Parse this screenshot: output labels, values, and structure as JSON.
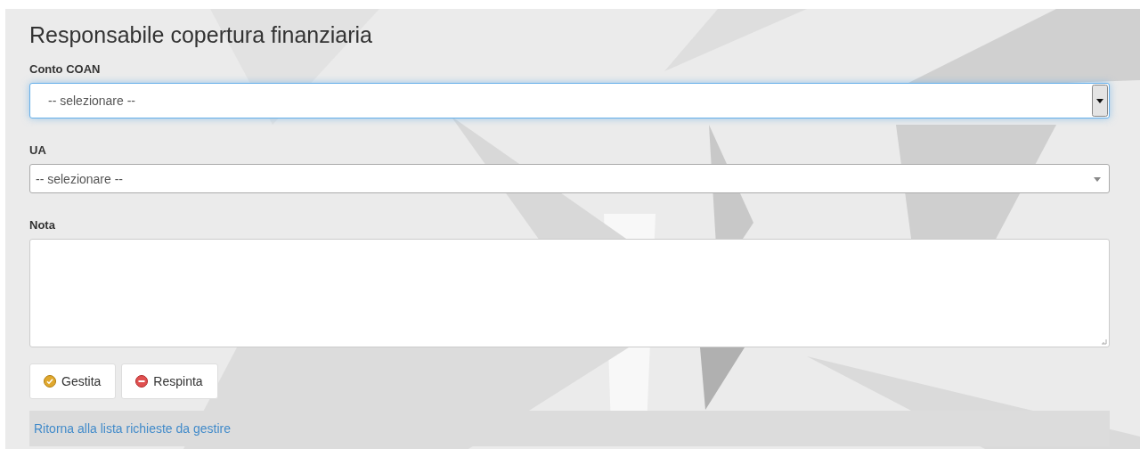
{
  "title": "Responsabile copertura finanziaria",
  "fields": [
    {
      "kind": "select",
      "label": "Conto COAN",
      "value": "-- selezionare --",
      "focused": true
    },
    {
      "kind": "select",
      "label": "UA",
      "value": "-- selezionare --",
      "focused": false
    },
    {
      "kind": "textarea",
      "label": "Nota"
    }
  ],
  "buttons": [
    {
      "label": "Gestita",
      "kind": "ok"
    },
    {
      "label": "Respinta",
      "kind": "reject"
    }
  ],
  "back_link": "Ritorna alla lista richieste da gestire"
}
